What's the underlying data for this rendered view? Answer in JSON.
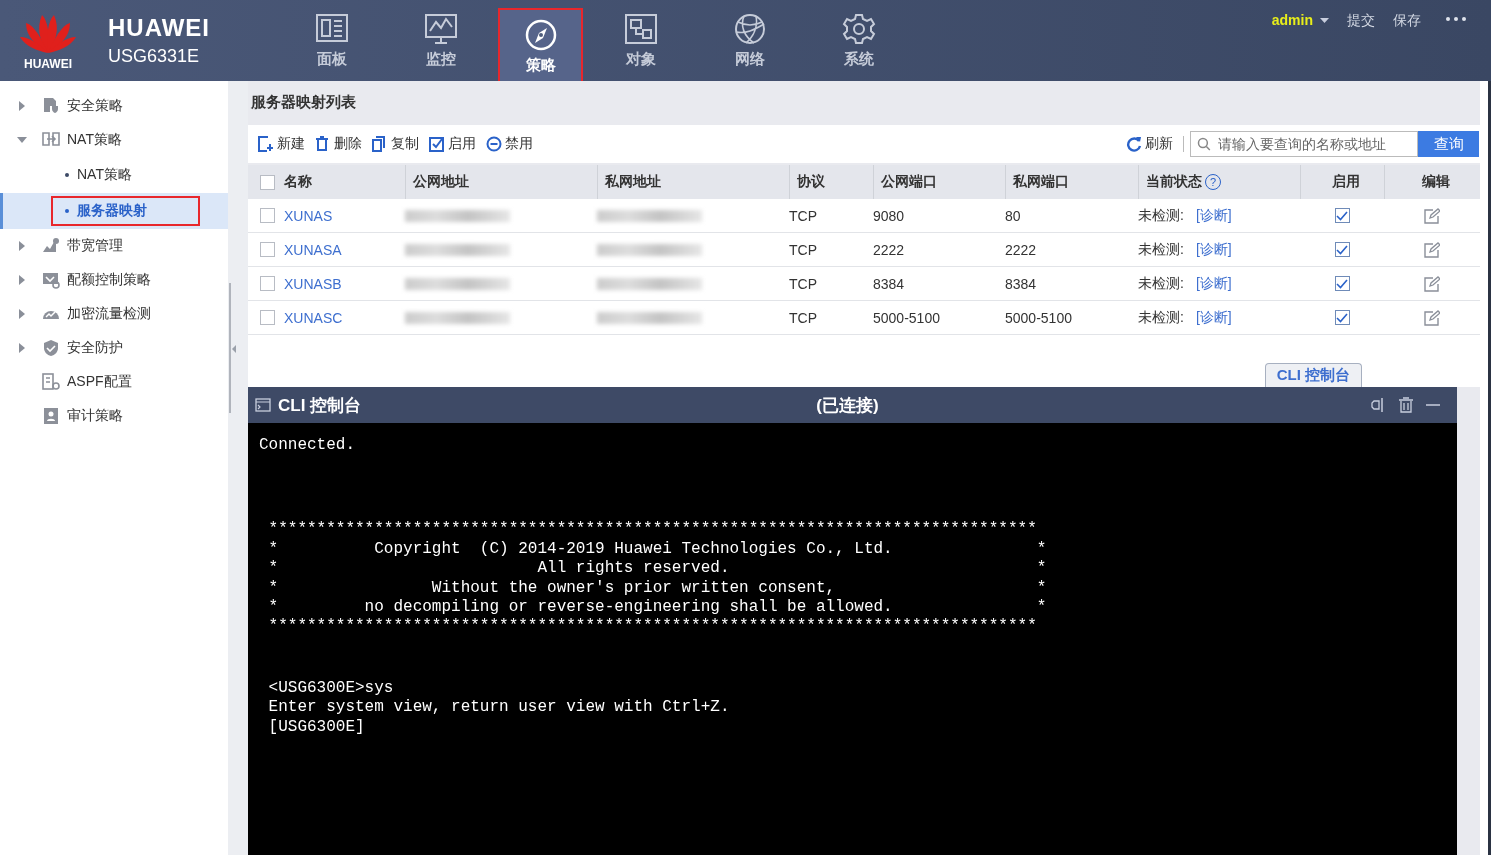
{
  "header": {
    "logo_caption": "HUAWEI",
    "brand": "HUAWEI",
    "model": "USG6331E",
    "nav": [
      {
        "label": "面板",
        "selected": false,
        "highlighted": false
      },
      {
        "label": "监控",
        "selected": false,
        "highlighted": false
      },
      {
        "label": "策略",
        "selected": true,
        "highlighted": true
      },
      {
        "label": "对象",
        "selected": false,
        "highlighted": false
      },
      {
        "label": "网络",
        "selected": false,
        "highlighted": false
      },
      {
        "label": "系统",
        "selected": false,
        "highlighted": false
      }
    ],
    "user": "admin",
    "actions": [
      "提交",
      "保存"
    ]
  },
  "sidebar": {
    "items": [
      {
        "label": "安全策略",
        "expandable": true,
        "expanded": false
      },
      {
        "label": "NAT策略",
        "expandable": true,
        "expanded": true,
        "children": [
          {
            "label": "NAT策略",
            "selected": false,
            "highlighted": false
          },
          {
            "label": "服务器映射",
            "selected": true,
            "highlighted": true
          }
        ]
      },
      {
        "label": "带宽管理",
        "expandable": true,
        "expanded": false
      },
      {
        "label": "配额控制策略",
        "expandable": true,
        "expanded": false
      },
      {
        "label": "加密流量检测",
        "expandable": true,
        "expanded": false
      },
      {
        "label": "安全防护",
        "expandable": true,
        "expanded": false
      },
      {
        "label": "ASPF配置",
        "expandable": false
      },
      {
        "label": "审计策略",
        "expandable": false
      }
    ]
  },
  "page": {
    "title": "服务器映射列表",
    "toolbar": [
      {
        "label": "新建"
      },
      {
        "label": "删除"
      },
      {
        "label": "复制"
      },
      {
        "label": "启用"
      },
      {
        "label": "禁用"
      }
    ],
    "refresh": "刷新",
    "search": {
      "placeholder": "请输入要查询的名称或地址",
      "button": "查询"
    },
    "table": {
      "all_checked": false,
      "columns": [
        {
          "label": "名称"
        },
        {
          "label": "公网地址"
        },
        {
          "label": "私网地址"
        },
        {
          "label": "协议"
        },
        {
          "label": "公网端口"
        },
        {
          "label": "私网端口"
        },
        {
          "label": "当前状态",
          "help": "?"
        },
        {
          "label": "启用"
        },
        {
          "label": "编辑"
        }
      ],
      "rows": [
        {
          "checked": false,
          "name": "XUNAS",
          "public_address_blurred": true,
          "private_address_blurred": true,
          "protocol": "TCP",
          "public_port": "9080",
          "private_port": "80",
          "status": "未检测:",
          "diagnose": "[诊断]",
          "enabled": true
        },
        {
          "checked": false,
          "name": "XUNASA",
          "public_address_blurred": true,
          "private_address_blurred": true,
          "protocol": "TCP",
          "public_port": "2222",
          "private_port": "2222",
          "status": "未检测:",
          "diagnose": "[诊断]",
          "enabled": true
        },
        {
          "checked": false,
          "name": "XUNASB",
          "public_address_blurred": true,
          "private_address_blurred": true,
          "protocol": "TCP",
          "public_port": "8384",
          "private_port": "8384",
          "status": "未检测:",
          "diagnose": "[诊断]",
          "enabled": true
        },
        {
          "checked": false,
          "name": "XUNASC",
          "public_address_blurred": true,
          "private_address_blurred": true,
          "protocol": "TCP",
          "public_port": "5000-5100",
          "private_port": "5000-5100",
          "status": "未检测:",
          "diagnose": "[诊断]",
          "enabled": true
        }
      ]
    }
  },
  "cli": {
    "tab": "CLI 控制台",
    "title": "CLI 控制台",
    "status": "(已连接)",
    "blocks": [
      [
        "Connected."
      ],
      [
        " ********************************************************************************",
        " *          Copyright  (C) 2014-2019 Huawei Technologies Co., Ltd.               *",
        " *                           All rights reserved.                                *",
        " *                Without the owner's prior written consent,                     *",
        " *         no decompiling or reverse-engineering shall be allowed.               *",
        " ********************************************************************************"
      ],
      [
        " <USG6300E>sys",
        " Enter system view, return user view with Ctrl+Z.",
        " [USG6300E]"
      ]
    ]
  }
}
